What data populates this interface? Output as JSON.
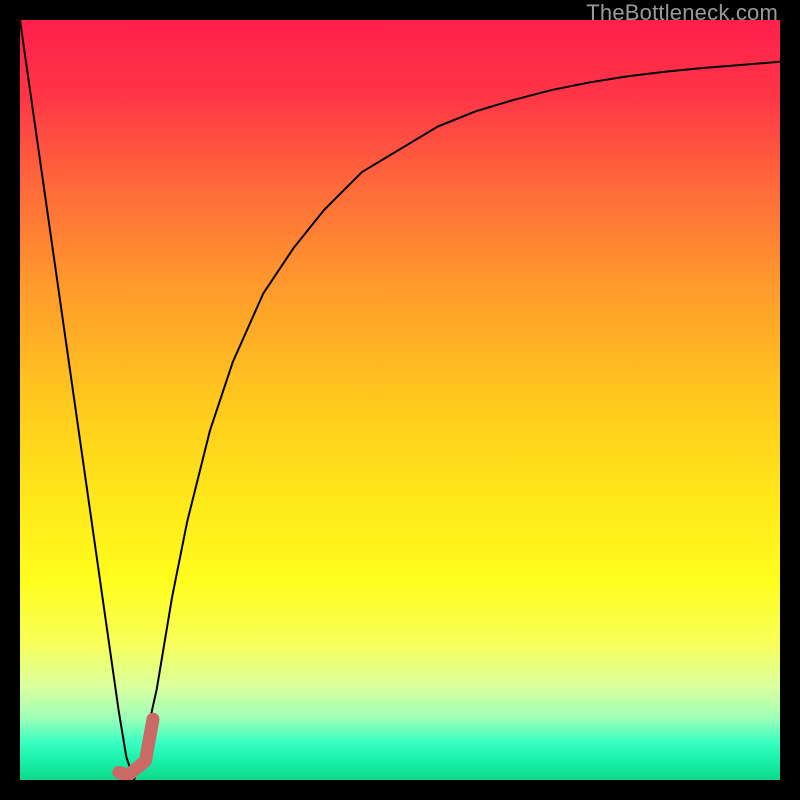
{
  "watermark": "TheBottleneck.com",
  "gradient": {
    "stops": [
      {
        "offset": 0.0,
        "color": "#ff1f4b"
      },
      {
        "offset": 0.1,
        "color": "#ff3647"
      },
      {
        "offset": 0.22,
        "color": "#ff6a3a"
      },
      {
        "offset": 0.35,
        "color": "#ff9a2c"
      },
      {
        "offset": 0.5,
        "color": "#ffc81e"
      },
      {
        "offset": 0.62,
        "color": "#ffe61a"
      },
      {
        "offset": 0.74,
        "color": "#fffd1e"
      },
      {
        "offset": 0.82,
        "color": "#f8ff5a"
      },
      {
        "offset": 0.88,
        "color": "#d8ffa0"
      },
      {
        "offset": 0.92,
        "color": "#9affb8"
      },
      {
        "offset": 0.95,
        "color": "#3affc3"
      },
      {
        "offset": 0.975,
        "color": "#18f0a8"
      },
      {
        "offset": 1.0,
        "color": "#0fd98a"
      }
    ]
  },
  "chart_data": {
    "type": "line",
    "title": "",
    "xlabel": "",
    "ylabel": "",
    "xlim": [
      0,
      100
    ],
    "ylim": [
      0,
      100
    ],
    "grid": false,
    "series": [
      {
        "name": "bottleneck-curve",
        "color": "#000000",
        "width": 2,
        "x": [
          0,
          2,
          4,
          6,
          8,
          10,
          12,
          13,
          14,
          15,
          16,
          18,
          20,
          22,
          25,
          28,
          32,
          36,
          40,
          45,
          50,
          55,
          60,
          65,
          70,
          75,
          80,
          85,
          90,
          95,
          100
        ],
        "y": [
          100,
          86,
          72,
          58,
          44,
          30,
          16,
          9,
          3,
          0,
          3,
          12,
          24,
          34,
          46,
          55,
          64,
          70,
          75,
          80,
          83,
          86,
          88,
          89.5,
          90.8,
          91.8,
          92.6,
          93.2,
          93.7,
          94.1,
          94.5
        ]
      },
      {
        "name": "marker-segment",
        "color": "#c96a66",
        "width": 13,
        "linecap": "round",
        "x": [
          13.0,
          14.2,
          16.5,
          17.5
        ],
        "y": [
          1.0,
          0.6,
          2.5,
          8.0
        ]
      }
    ]
  }
}
